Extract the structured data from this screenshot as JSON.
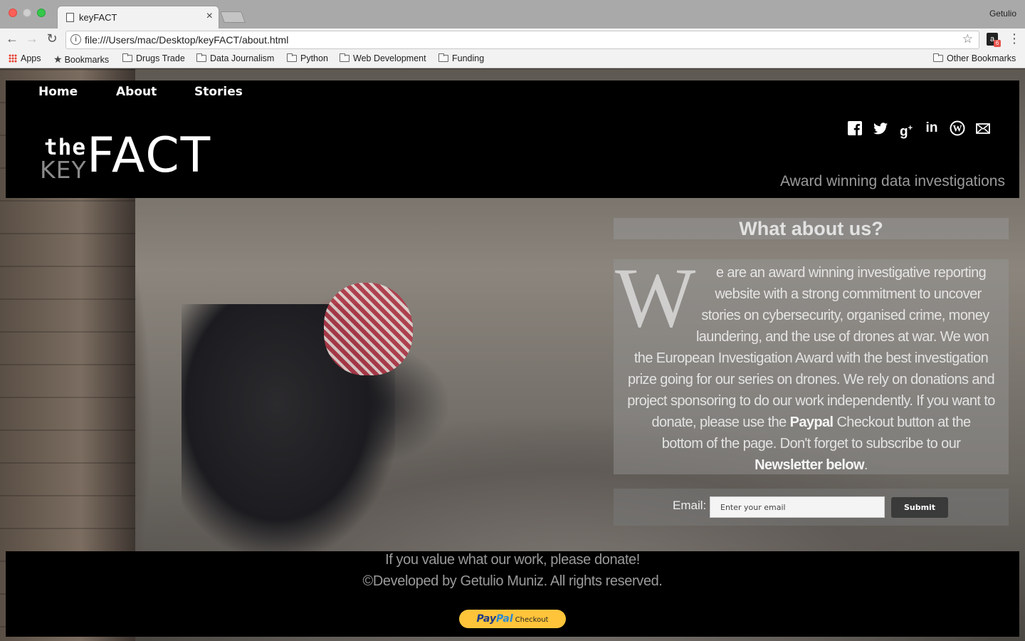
{
  "browser": {
    "tab_title": "keyFACT",
    "profile_name": "Getulio",
    "url": "file:///Users/mac/Desktop/keyFACT/about.html",
    "bookmarks": [
      {
        "label": "Apps",
        "icon": "apps-grid-icon"
      },
      {
        "label": "Bookmarks",
        "icon": "star-icon"
      },
      {
        "label": "Drugs Trade",
        "icon": "folder-icon"
      },
      {
        "label": "Data Journalism",
        "icon": "folder-icon"
      },
      {
        "label": "Python",
        "icon": "folder-icon"
      },
      {
        "label": "Web Development",
        "icon": "folder-icon"
      },
      {
        "label": "Funding",
        "icon": "folder-icon"
      }
    ],
    "other_bookmarks": "Other Bookmarks",
    "extension_badge": "6"
  },
  "nav": {
    "home": "Home",
    "about": "About",
    "stories": "Stories"
  },
  "logo": {
    "the": "the",
    "key": "KEY",
    "fact": "FACT"
  },
  "socials": [
    "facebook-icon",
    "twitter-icon",
    "google-plus-icon",
    "linkedin-icon",
    "wordpress-icon",
    "email-icon"
  ],
  "tagline": "Award winning data investigations",
  "about": {
    "title": "What about us?",
    "dropcap": "W",
    "lines": [
      "e are an award winning investigative reporting",
      "website with a strong commitment to uncover",
      "stories on cybersecurity, organised crime, money",
      "laundering, and the use of drones at war. We won",
      "the European Investigation Award with the best investigation",
      "prize going for our series on drones. We rely on donations and",
      "project sponsoring to do our work independently. If you want to",
      "donate, please use the",
      "Paypal",
      "Checkout button at the",
      "bottom of the page. Don't forget to subscribe to our",
      "Newsletter below",
      "."
    ]
  },
  "newsletter": {
    "label": "Email:",
    "placeholder": "Enter your email",
    "submit": "Submit"
  },
  "footer": {
    "donate_line": "If you value what our work, please donate!",
    "copyright": "©Developed by Getulio Muniz. All rights reserved.",
    "paypal_pay": "Pay",
    "paypal_pal": "Pal",
    "paypal_checkout": "Checkout"
  }
}
